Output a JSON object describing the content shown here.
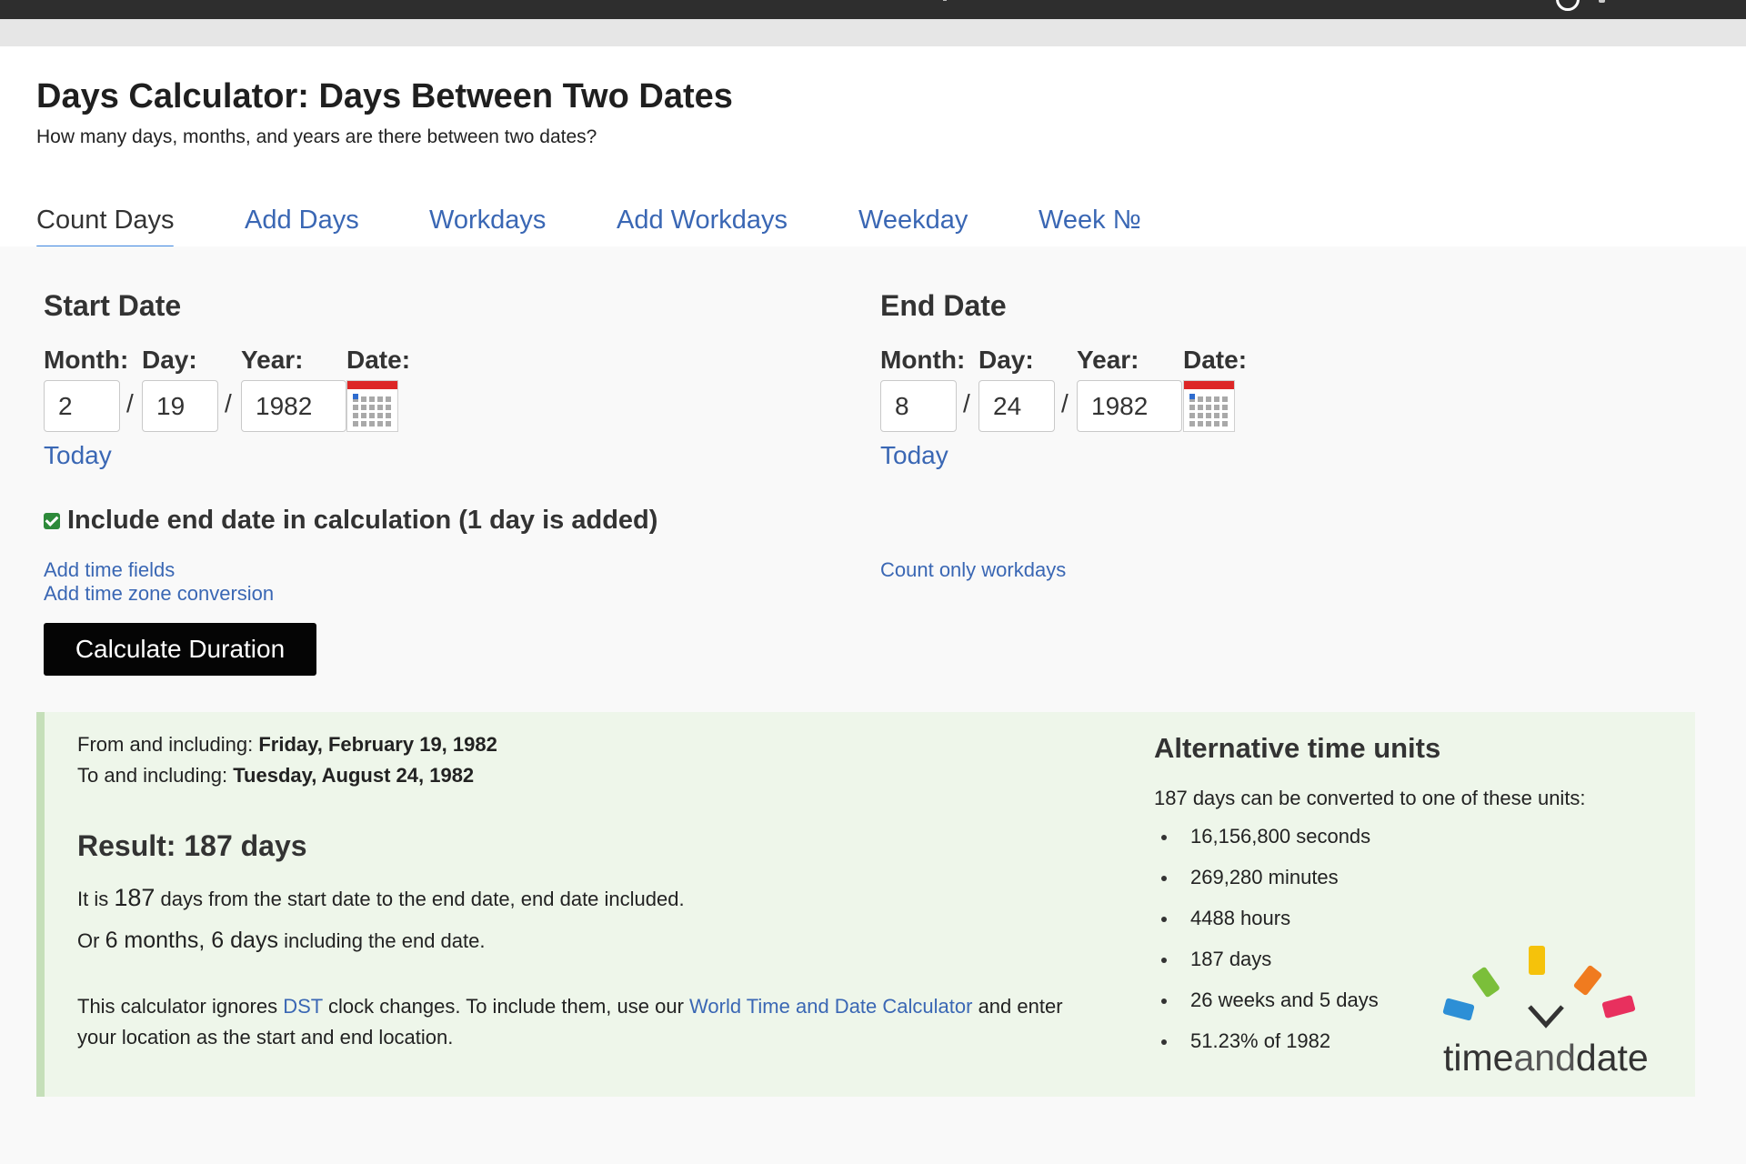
{
  "page": {
    "title": "Days Calculator: Days Between Two Dates",
    "subtitle": "How many days, months, and years are there between two dates?"
  },
  "tabs": [
    {
      "label": "Count Days",
      "active": true
    },
    {
      "label": "Add Days"
    },
    {
      "label": "Workdays"
    },
    {
      "label": "Add Workdays"
    },
    {
      "label": "Weekday"
    },
    {
      "label": "Week №"
    }
  ],
  "start": {
    "heading": "Start Date",
    "month_label": "Month:",
    "day_label": "Day:",
    "year_label": "Year:",
    "date_label": "Date:",
    "month": "2",
    "day": "19",
    "year": "1982",
    "today_link": "Today"
  },
  "end": {
    "heading": "End Date",
    "month_label": "Month:",
    "day_label": "Day:",
    "year_label": "Year:",
    "date_label": "Date:",
    "month": "8",
    "day": "24",
    "year": "1982",
    "today_link": "Today"
  },
  "separator": "/",
  "options": {
    "include_end_label": "Include end date in calculation (1 day is added)",
    "include_end_checked": true,
    "add_time_fields": "Add time fields",
    "add_time_zone": "Add time zone conversion",
    "count_workdays": "Count only workdays"
  },
  "button": {
    "calculate": "Calculate Duration"
  },
  "result": {
    "from_prefix": "From and including:",
    "from_date": "Friday, February 19, 1982",
    "to_prefix": "To and including:",
    "to_date": "Tuesday, August 24, 1982",
    "heading": "Result: 187 days",
    "line1_prefix": "It is",
    "line1_number": "187",
    "line1_suffix": "days from the start date to the end date, end date included.",
    "line2_prefix": "Or",
    "line2_value": "6 months, 6 days",
    "line2_suffix": "including the end date.",
    "note_1": "This calculator ignores",
    "note_dst": "DST",
    "note_2": "clock changes. To include them, use our",
    "note_link": "World Time and Date Calculator",
    "note_3": "and enter",
    "note_4": "your location as the start and end location."
  },
  "alt": {
    "heading": "Alternative time units",
    "intro": "187 days can be converted to one of these units:",
    "items": [
      "16,156,800 seconds",
      "269,280 minutes",
      "4488 hours",
      "187 days",
      "26 weeks and 5 days",
      "51.23% of 1982"
    ]
  },
  "logo": {
    "text_1": "time",
    "text_2": "and",
    "text_3": "date"
  },
  "colors": {
    "link": "#3a67b4",
    "tab_underline": "#3e86e0",
    "result_bg": "#eef6ea",
    "result_border": "#c5dfb9",
    "checkbox": "#2d8a3a",
    "button_bg": "#050505"
  }
}
